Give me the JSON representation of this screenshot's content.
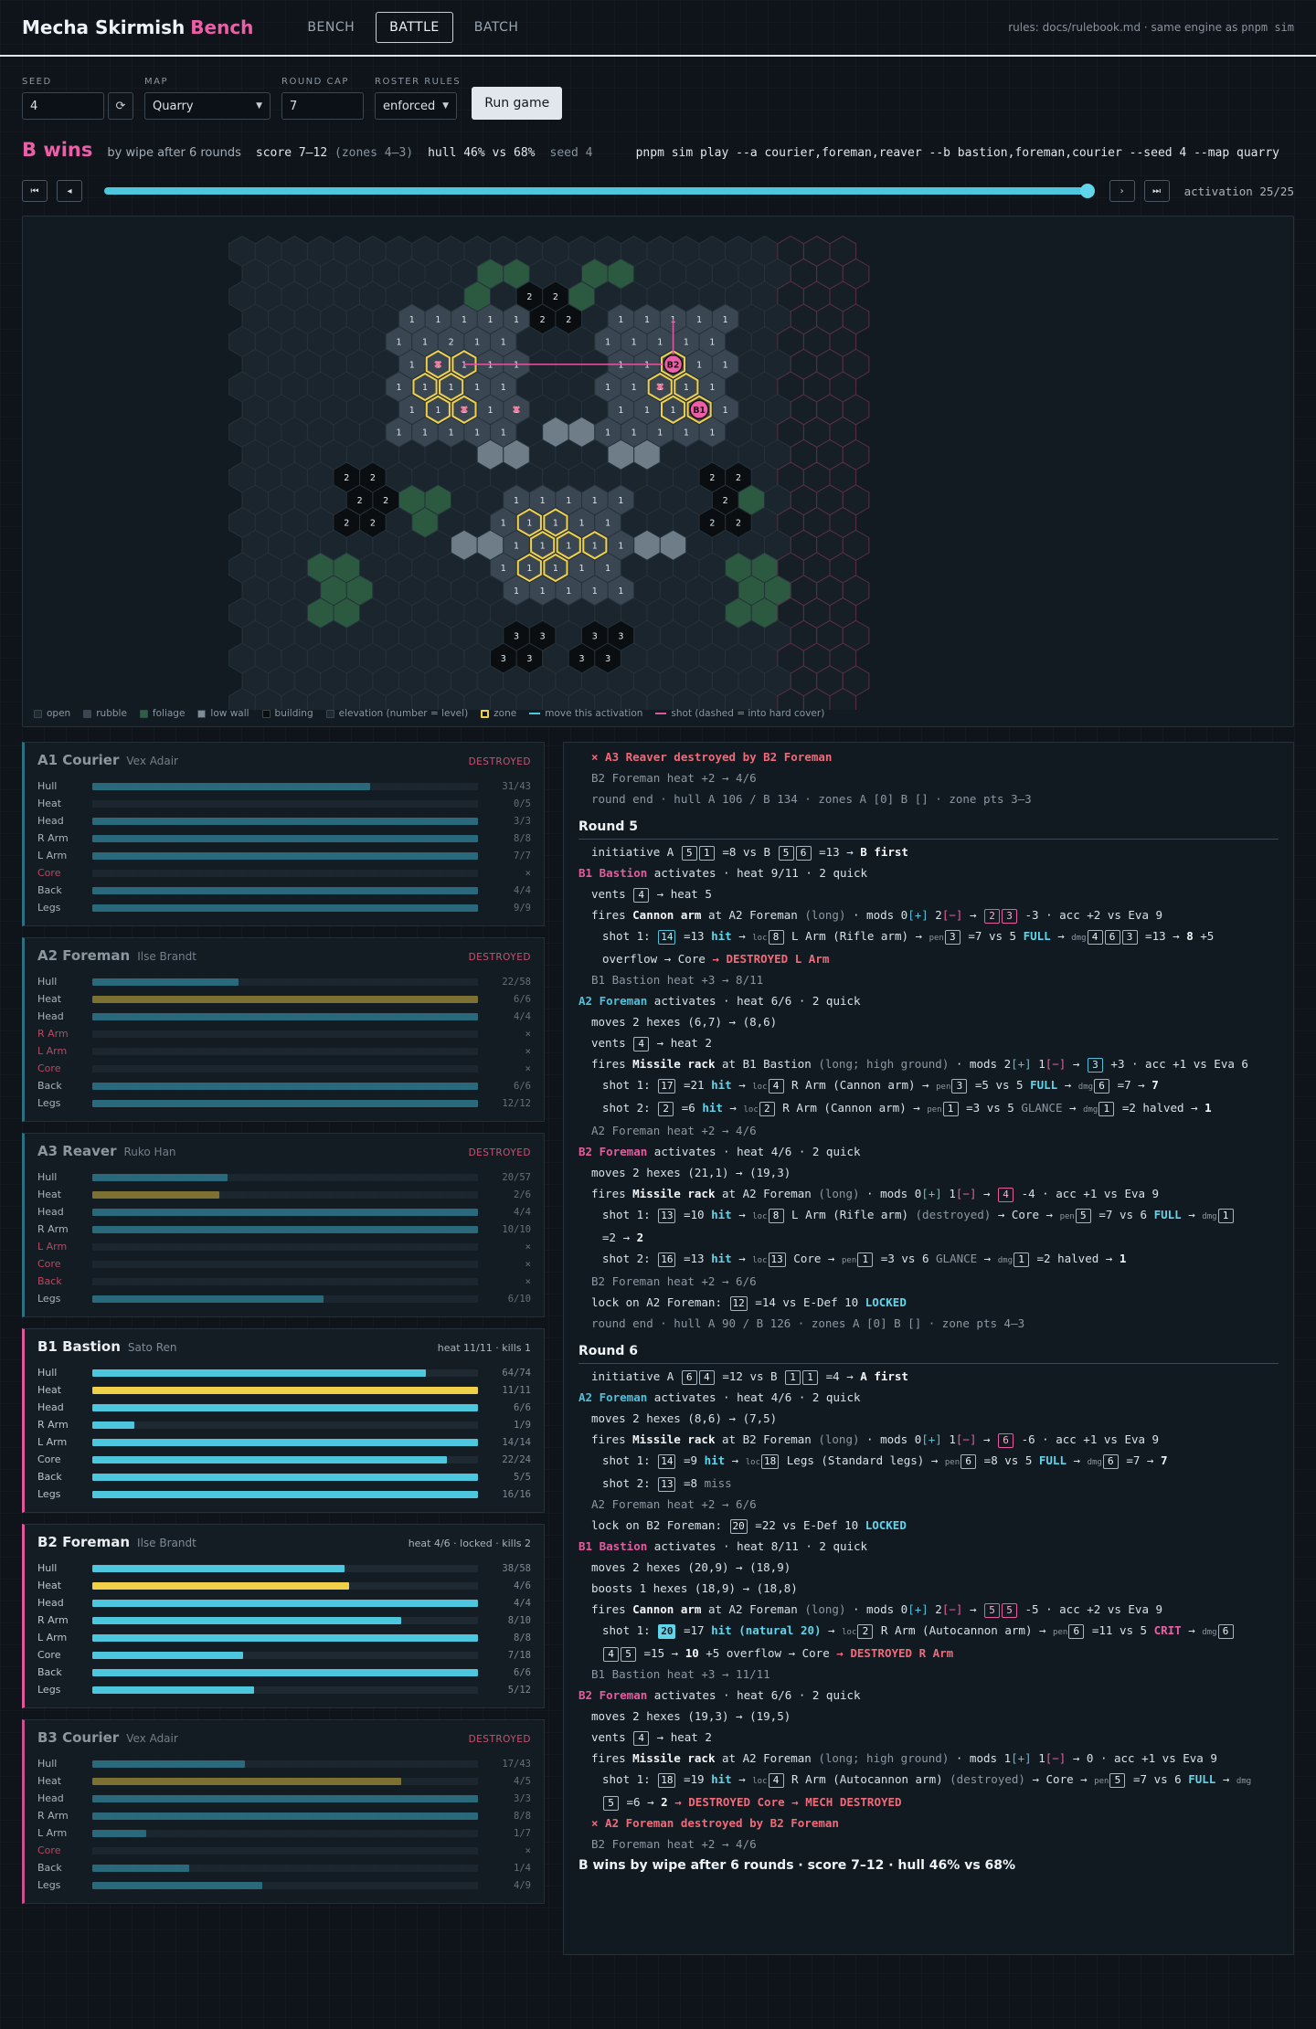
{
  "header": {
    "title": "Mecha Skirmish",
    "title_accent": "Bench",
    "tabs": [
      "BENCH",
      "BATTLE",
      "BATCH"
    ],
    "active_tab": "BATTLE",
    "rules_prefix": "rules: docs/rulebook.md · same engine as ",
    "rules_cmd": "pnpm sim"
  },
  "controls": {
    "seed_label": "SEED",
    "seed_value": "4",
    "reseed_icon": "⟳",
    "map_label": "MAP",
    "map_value": "Quarry",
    "round_cap_label": "ROUND CAP",
    "round_cap_value": "7",
    "roster_label": "ROSTER RULES",
    "roster_value": "enforced",
    "run_label": "Run game"
  },
  "result": {
    "winner": "B wins",
    "by": "by wipe after 6 rounds",
    "score": "score 7–12",
    "zones": "(zones 4–3)",
    "hull": "hull 46% vs 68%",
    "seed": "seed 4",
    "command": "pnpm sim play --a courier,foreman,reaver --b bastion,foreman,courier --seed 4 --map quarry"
  },
  "timeline": {
    "first_icon": "⏮",
    "prev_icon": "◂",
    "next_icon": "›",
    "last_icon": "⏭",
    "current": 25,
    "total": 25,
    "label": "activation 25/25"
  },
  "legend": [
    {
      "label": "open",
      "color": "#1e2a32"
    },
    {
      "label": "rubble",
      "color": "#3a4651"
    },
    {
      "label": "foliage",
      "color": "#2f5e44"
    },
    {
      "label": "low wall",
      "color": "#7f8c96"
    },
    {
      "label": "building",
      "color": "#0a0e11"
    },
    {
      "label": "elevation (number = level)",
      "color": "#1e2a32"
    },
    {
      "label": "zone",
      "color": "#f0d049"
    },
    {
      "label": "move this activation",
      "color": "#4cc7dd"
    },
    {
      "label": "shot (dashed = into hard cover)",
      "color": "#e0579f"
    }
  ],
  "map": {
    "mech_labels": [
      "B2",
      "B1"
    ],
    "colors": {
      "teamA": "#4cc7dd",
      "teamB": "#e0579f",
      "zone": "#f0d049"
    }
  },
  "units": [
    {
      "name": "A1 Courier",
      "pilot": "Vex Adair",
      "team": "A",
      "status": "DESTROYED",
      "destroyed": true,
      "bars": [
        {
          "label": "Hull",
          "value": "31/43",
          "frac": 0.72,
          "kind": "hull"
        },
        {
          "label": "Heat",
          "value": "0/5",
          "frac": 0,
          "kind": "heat"
        },
        {
          "label": "Head",
          "value": "3/3",
          "frac": 1,
          "kind": "part"
        },
        {
          "label": "R Arm",
          "value": "8/8",
          "frac": 1,
          "kind": "part"
        },
        {
          "label": "L Arm",
          "value": "7/7",
          "frac": 1,
          "kind": "part"
        },
        {
          "label": "Core",
          "value": "×",
          "frac": 0,
          "kind": "part",
          "destroyed": true
        },
        {
          "label": "Back",
          "value": "4/4",
          "frac": 1,
          "kind": "part"
        },
        {
          "label": "Legs",
          "value": "9/9",
          "frac": 1,
          "kind": "part"
        }
      ]
    },
    {
      "name": "A2 Foreman",
      "pilot": "Ilse Brandt",
      "team": "A",
      "status": "DESTROYED",
      "destroyed": true,
      "bars": [
        {
          "label": "Hull",
          "value": "22/58",
          "frac": 0.38,
          "kind": "hull"
        },
        {
          "label": "Heat",
          "value": "6/6",
          "frac": 1,
          "kind": "heat"
        },
        {
          "label": "Head",
          "value": "4/4",
          "frac": 1,
          "kind": "part"
        },
        {
          "label": "R Arm",
          "value": "×",
          "frac": 0,
          "kind": "part",
          "destroyed": true
        },
        {
          "label": "L Arm",
          "value": "×",
          "frac": 0,
          "kind": "part",
          "destroyed": true
        },
        {
          "label": "Core",
          "value": "×",
          "frac": 0,
          "kind": "part",
          "destroyed": true
        },
        {
          "label": "Back",
          "value": "6/6",
          "frac": 1,
          "kind": "part"
        },
        {
          "label": "Legs",
          "value": "12/12",
          "frac": 1,
          "kind": "part"
        }
      ]
    },
    {
      "name": "A3 Reaver",
      "pilot": "Ruko Han",
      "team": "A",
      "status": "DESTROYED",
      "destroyed": true,
      "bars": [
        {
          "label": "Hull",
          "value": "20/57",
          "frac": 0.35,
          "kind": "hull"
        },
        {
          "label": "Heat",
          "value": "2/6",
          "frac": 0.33,
          "kind": "heat"
        },
        {
          "label": "Head",
          "value": "4/4",
          "frac": 1,
          "kind": "part"
        },
        {
          "label": "R Arm",
          "value": "10/10",
          "frac": 1,
          "kind": "part"
        },
        {
          "label": "L Arm",
          "value": "×",
          "frac": 0,
          "kind": "part",
          "destroyed": true
        },
        {
          "label": "Core",
          "value": "×",
          "frac": 0,
          "kind": "part",
          "destroyed": true
        },
        {
          "label": "Back",
          "value": "×",
          "frac": 0,
          "kind": "part",
          "destroyed": true
        },
        {
          "label": "Legs",
          "value": "6/10",
          "frac": 0.6,
          "kind": "part"
        }
      ]
    },
    {
      "name": "B1 Bastion",
      "pilot": "Sato Ren",
      "team": "B",
      "status": "heat 11/11 · kills 1",
      "destroyed": false,
      "bars": [
        {
          "label": "Hull",
          "value": "64/74",
          "frac": 0.865,
          "kind": "hull"
        },
        {
          "label": "Heat",
          "value": "11/11",
          "frac": 1,
          "kind": "heat"
        },
        {
          "label": "Head",
          "value": "6/6",
          "frac": 1,
          "kind": "part"
        },
        {
          "label": "R Arm",
          "value": "1/9",
          "frac": 0.11,
          "kind": "part"
        },
        {
          "label": "L Arm",
          "value": "14/14",
          "frac": 1,
          "kind": "part"
        },
        {
          "label": "Core",
          "value": "22/24",
          "frac": 0.92,
          "kind": "part"
        },
        {
          "label": "Back",
          "value": "5/5",
          "frac": 1,
          "kind": "part"
        },
        {
          "label": "Legs",
          "value": "16/16",
          "frac": 1,
          "kind": "part"
        }
      ]
    },
    {
      "name": "B2 Foreman",
      "pilot": "Ilse Brandt",
      "team": "B",
      "status": "heat 4/6 · locked · kills 2",
      "destroyed": false,
      "bars": [
        {
          "label": "Hull",
          "value": "38/58",
          "frac": 0.655,
          "kind": "hull"
        },
        {
          "label": "Heat",
          "value": "4/6",
          "frac": 0.667,
          "kind": "heat"
        },
        {
          "label": "Head",
          "value": "4/4",
          "frac": 1,
          "kind": "part"
        },
        {
          "label": "R Arm",
          "value": "8/10",
          "frac": 0.8,
          "kind": "part"
        },
        {
          "label": "L Arm",
          "value": "8/8",
          "frac": 1,
          "kind": "part"
        },
        {
          "label": "Core",
          "value": "7/18",
          "frac": 0.39,
          "kind": "part"
        },
        {
          "label": "Back",
          "value": "6/6",
          "frac": 1,
          "kind": "part"
        },
        {
          "label": "Legs",
          "value": "5/12",
          "frac": 0.42,
          "kind": "part"
        }
      ]
    },
    {
      "name": "B3 Courier",
      "pilot": "Vex Adair",
      "team": "B",
      "status": "DESTROYED",
      "destroyed": true,
      "bars": [
        {
          "label": "Hull",
          "value": "17/43",
          "frac": 0.395,
          "kind": "hull"
        },
        {
          "label": "Heat",
          "value": "4/5",
          "frac": 0.8,
          "kind": "heat"
        },
        {
          "label": "Head",
          "value": "3/3",
          "frac": 1,
          "kind": "part"
        },
        {
          "label": "R Arm",
          "value": "8/8",
          "frac": 1,
          "kind": "part"
        },
        {
          "label": "L Arm",
          "value": "1/7",
          "frac": 0.14,
          "kind": "part"
        },
        {
          "label": "Core",
          "value": "×",
          "frac": 0,
          "kind": "part",
          "destroyed": true
        },
        {
          "label": "Back",
          "value": "1/4",
          "frac": 0.25,
          "kind": "part"
        },
        {
          "label": "Legs",
          "value": "4/9",
          "frac": 0.44,
          "kind": "part"
        }
      ]
    }
  ],
  "log": [
    {
      "cls": "destroy i1",
      "html": "× A3 Reaver destroyed by B2 Foreman"
    },
    {
      "cls": "dim i1",
      "html": "B2 Foreman heat +2 → 4/6"
    },
    {
      "cls": "dim i1",
      "html": "round end · hull A 106 / B 134 · zones A [0] B [] · zone pts 3–3"
    },
    {
      "cls": "round",
      "html": "Round 5"
    },
    {
      "cls": "i1",
      "html": "initiative A <span class='die'>5</span><span class='die'>1</span> =8 vs B <span class='die'>5</span><span class='die'>6</span> =13 → <span class='bold'>B first</span>"
    },
    {
      "cls": "",
      "html": "<span class='b'>B1 Bastion</span> activates · heat 9/11 · 2 quick"
    },
    {
      "cls": "i1",
      "html": "vents <span class='die'>4</span> → heat 5"
    },
    {
      "cls": "i1",
      "html": "fires <span class='bold'>Cannon arm</span> at A2 Foreman <span class='muted'>(long)</span> · mods 0<span class='plus'>[+]</span> 2<span class='minus'>[−]</span> → <span class='die pink'>2</span><span class='die pink'>3</span> -3 · acc +2 vs Eva 9"
    },
    {
      "cls": "i2",
      "html": "shot 1: <span class='die cyan'>14</span> =13 <span class='hit'>hit</span> → <span class='tiny'>loc</span><span class='die'>8</span> L Arm (Rifle arm) → <span class='tiny'>pen</span><span class='die'>3</span> =7 vs 5 <span class='full'>FULL</span> → <span class='tiny'>dmg</span><span class='die'>4</span><span class='die'>6</span><span class='die'>3</span> =13 → <span class='bold'>8</span> +5"
    },
    {
      "cls": "i2",
      "html": "overflow → Core <span class='red'>→ DESTROYED L Arm</span>"
    },
    {
      "cls": "dim i1",
      "html": "B1 Bastion heat +3 → 8/11"
    },
    {
      "cls": "",
      "html": "<span class='a'>A2 Foreman</span> activates · heat 6/6 · 2 quick"
    },
    {
      "cls": "i1",
      "html": "moves 2 hexes (6,7) → (8,6)"
    },
    {
      "cls": "i1",
      "html": "vents <span class='die'>4</span> → heat 2"
    },
    {
      "cls": "i1",
      "html": "fires <span class='bold'>Missile rack</span> at B1 Bastion <span class='muted'>(long; high ground)</span> · mods 2<span class='plus'>[+]</span> 1<span class='minus'>[−]</span> → <span class='die cyan'>3</span> +3 · acc +1 vs Eva 6"
    },
    {
      "cls": "i2",
      "html": "shot 1: <span class='die'>17</span> =21 <span class='hit'>hit</span> → <span class='tiny'>loc</span><span class='die'>4</span> R Arm (Cannon arm) → <span class='tiny'>pen</span><span class='die'>3</span> =5 vs 5 <span class='full'>FULL</span> → <span class='tiny'>dmg</span><span class='die'>6</span> =7 → <span class='bold'>7</span>"
    },
    {
      "cls": "i2",
      "html": "shot 2: <span class='die'>2</span> =6 <span class='hit'>hit</span> → <span class='tiny'>loc</span><span class='die'>2</span> R Arm (Cannon arm) → <span class='tiny'>pen</span><span class='die'>1</span> =3 vs 5 <span class='muted'>GLANCE</span> → <span class='tiny'>dmg</span><span class='die'>1</span> =2 halved → <span class='bold'>1</span>"
    },
    {
      "cls": "dim i1",
      "html": "A2 Foreman heat +2 → 4/6"
    },
    {
      "cls": "",
      "html": "<span class='b'>B2 Foreman</span> activates · heat 4/6 · 2 quick"
    },
    {
      "cls": "i1",
      "html": "moves 2 hexes (21,1) → (19,3)"
    },
    {
      "cls": "i1",
      "html": "fires <span class='bold'>Missile rack</span> at A2 Foreman <span class='muted'>(long)</span> · mods 0<span class='plus'>[+]</span> 1<span class='minus'>[−]</span> → <span class='die pink'>4</span> -4 · acc +1 vs Eva 9"
    },
    {
      "cls": "i2",
      "html": "shot 1: <span class='die'>13</span> =10 <span class='hit'>hit</span> → <span class='tiny'>loc</span><span class='die'>8</span> L Arm (Rifle arm) <span class='muted'>(destroyed)</span> → Core → <span class='tiny'>pen</span><span class='die'>5</span> =7 vs 6 <span class='full'>FULL</span> → <span class='tiny'>dmg</span><span class='die'>1</span>"
    },
    {
      "cls": "i2",
      "html": "=2 → <span class='bold'>2</span>"
    },
    {
      "cls": "i2",
      "html": "shot 2: <span class='die'>16</span> =13 <span class='hit'>hit</span> → <span class='tiny'>loc</span><span class='die'>13</span> Core → <span class='tiny'>pen</span><span class='die'>1</span> =3 vs 6 <span class='muted'>GLANCE</span> → <span class='tiny'>dmg</span><span class='die'>1</span> =2 halved → <span class='bold'>1</span>"
    },
    {
      "cls": "dim i1",
      "html": "B2 Foreman heat +2 → 6/6"
    },
    {
      "cls": "i1",
      "html": "lock on A2 Foreman: <span class='die'>12</span> =14 vs E-Def 10 <span class='locked'>LOCKED</span>"
    },
    {
      "cls": "dim i1",
      "html": "round end · hull A 90 / B 126 · zones A [0] B [] · zone pts 4–3"
    },
    {
      "cls": "round",
      "html": "Round 6"
    },
    {
      "cls": "i1",
      "html": "initiative A <span class='die'>6</span><span class='die'>4</span> =12 vs B <span class='die'>1</span><span class='die'>1</span> =4 → <span class='bold'>A first</span>"
    },
    {
      "cls": "",
      "html": "<span class='a'>A2 Foreman</span> activates · heat 4/6 · 2 quick"
    },
    {
      "cls": "i1",
      "html": "moves 2 hexes (8,6) → (7,5)"
    },
    {
      "cls": "i1",
      "html": "fires <span class='bold'>Missile rack</span> at B2 Foreman <span class='muted'>(long)</span> · mods 0<span class='plus'>[+]</span> 1<span class='minus'>[−]</span> → <span class='die pink'>6</span> -6 · acc +1 vs Eva 9"
    },
    {
      "cls": "i2",
      "html": "shot 1: <span class='die'>14</span> =9 <span class='hit'>hit</span> → <span class='tiny'>loc</span><span class='die'>18</span> Legs (Standard legs) → <span class='tiny'>pen</span><span class='die'>6</span> =8 vs 5 <span class='full'>FULL</span> → <span class='tiny'>dmg</span><span class='die'>6</span> =7 → <span class='bold'>7</span>"
    },
    {
      "cls": "i2",
      "html": "shot 2: <span class='die'>13</span> =8 <span class='muted'>miss</span>"
    },
    {
      "cls": "dim i1",
      "html": "A2 Foreman heat +2 → 6/6"
    },
    {
      "cls": "i1",
      "html": "lock on B2 Foreman: <span class='die'>20</span> =22 vs E-Def 10 <span class='locked'>LOCKED</span>"
    },
    {
      "cls": "",
      "html": "<span class='b'>B1 Bastion</span> activates · heat 8/11 · 2 quick"
    },
    {
      "cls": "i1",
      "html": "moves 2 hexes (20,9) → (18,9)"
    },
    {
      "cls": "i1",
      "html": "boosts 1 hexes (18,9) → (18,8)"
    },
    {
      "cls": "i1",
      "html": "fires <span class='bold'>Cannon arm</span> at A2 Foreman <span class='muted'>(long)</span> · mods 0<span class='plus'>[+]</span> 2<span class='minus'>[−]</span> → <span class='die pink'>5</span><span class='die pink'>5</span> -5 · acc +2 vs Eva 9"
    },
    {
      "cls": "i2",
      "html": "shot 1: <span class='die nat'>20</span> =17 <span class='hit'>hit (natural 20)</span> → <span class='tiny'>loc</span><span class='die'>2</span> R Arm (Autocannon arm) → <span class='tiny'>pen</span><span class='die'>6</span> =11 vs 5 <span class='crit'>CRIT</span> → <span class='tiny'>dmg</span><span class='die'>6</span>"
    },
    {
      "cls": "i2",
      "html": "<span class='die'>4</span><span class='die'>5</span> =15 → <span class='bold'>10</span> +5 overflow → Core <span class='red'>→ DESTROYED R Arm</span>"
    },
    {
      "cls": "dim i1",
      "html": "B1 Bastion heat +3 → 11/11"
    },
    {
      "cls": "",
      "html": "<span class='b'>B2 Foreman</span> activates · heat 6/6 · 2 quick"
    },
    {
      "cls": "i1",
      "html": "moves 2 hexes (19,3) → (19,5)"
    },
    {
      "cls": "i1",
      "html": "vents <span class='die'>4</span> → heat 2"
    },
    {
      "cls": "i1",
      "html": "fires <span class='bold'>Missile rack</span> at A2 Foreman <span class='muted'>(long; high ground)</span> · mods 1<span class='plus'>[+]</span> 1<span class='minus'>[−]</span> → 0 · acc +1 vs Eva 9"
    },
    {
      "cls": "i2",
      "html": "shot 1: <span class='die'>18</span> =19 <span class='hit'>hit</span> → <span class='tiny'>loc</span><span class='die'>4</span> R Arm (Autocannon arm) <span class='muted'>(destroyed)</span> → Core → <span class='tiny'>pen</span><span class='die'>5</span> =7 vs 6 <span class='full'>FULL</span> → <span class='tiny'>dmg</span>"
    },
    {
      "cls": "i2",
      "html": "<span class='die'>5</span> =6 → <span class='bold'>2</span> <span class='red'>→ DESTROYED Core → MECH DESTROYED</span>"
    },
    {
      "cls": "destroy i1",
      "html": "× A2 Foreman destroyed by B2 Foreman"
    },
    {
      "cls": "dim i1",
      "html": "B2 Foreman heat +2 → 4/6"
    },
    {
      "cls": "final",
      "html": "B wins by wipe after 6 rounds · score 7–12 · hull 46% vs 68%"
    }
  ]
}
